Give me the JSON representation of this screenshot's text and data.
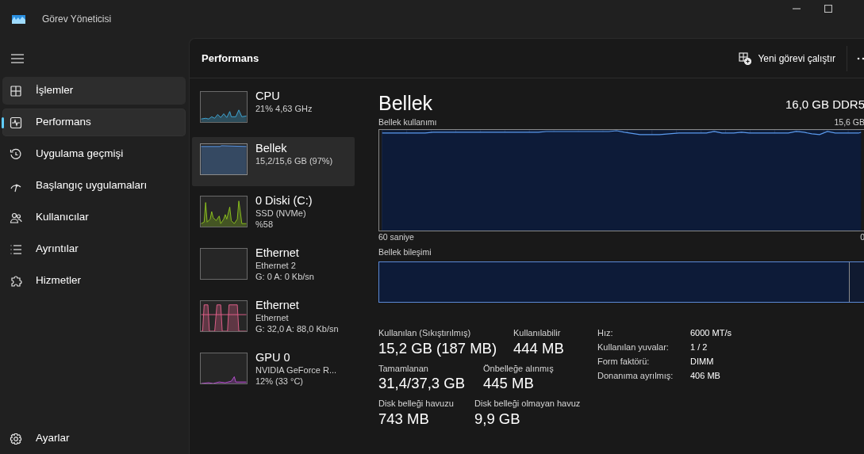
{
  "window": {
    "title": "Görev Yöneticisi"
  },
  "sidebar": {
    "items": [
      {
        "label": "İşlemler",
        "selected": false,
        "hovered": true
      },
      {
        "label": "Performans",
        "selected": true,
        "hovered": false
      },
      {
        "label": "Uygulama geçmişi",
        "selected": false,
        "hovered": false
      },
      {
        "label": "Başlangıç uygulamaları",
        "selected": false,
        "hovered": false
      },
      {
        "label": "Kullanıcılar",
        "selected": false,
        "hovered": false
      },
      {
        "label": "Ayrıntılar",
        "selected": false,
        "hovered": false
      },
      {
        "label": "Hizmetler",
        "selected": false,
        "hovered": false
      }
    ],
    "settings": {
      "label": "Ayarlar"
    }
  },
  "header": {
    "title": "Performans",
    "action": "Yeni görevi çalıştır"
  },
  "devices": [
    {
      "name": "CPU",
      "lines": [
        "21%  4,63 GHz"
      ],
      "selected": false
    },
    {
      "name": "Bellek",
      "lines": [
        "15,2/15,6 GB (97%)"
      ],
      "selected": true
    },
    {
      "name": "0 Diski (C:)",
      "lines": [
        "SSD (NVMe)",
        "%58"
      ],
      "selected": false
    },
    {
      "name": "Ethernet",
      "lines": [
        "Ethernet 2",
        "G: 0 A: 0 Kb/sn"
      ],
      "selected": false
    },
    {
      "name": "Ethernet",
      "lines": [
        "Ethernet",
        "G: 32,0 A: 88,0 Kb/sn"
      ],
      "selected": false
    },
    {
      "name": "GPU 0",
      "lines": [
        "NVIDIA GeForce R...",
        "12%  (33 °C)"
      ],
      "selected": false
    }
  ],
  "detail": {
    "title": "Bellek",
    "spec": "16,0 GB DDR5",
    "usage": {
      "label": "Bellek kullanımı",
      "max": "15,6 GB",
      "time": "60 saniye",
      "min": "0"
    },
    "composition": {
      "label": "Bellek bileşimi",
      "level": 0.97
    },
    "stats": [
      [
        {
          "label": "Kullanılan (Sıkıştırılmış)",
          "value": "15,2 GB (187 MB)"
        },
        {
          "label": "Kullanılabilir",
          "value": "444 MB"
        }
      ],
      [
        {
          "label": "Tamamlanan",
          "value": "31,4/37,3 GB"
        },
        {
          "label": "Önbelleğe alınmış",
          "value": "445 MB"
        }
      ],
      [
        {
          "label": "Disk belleği havuzu",
          "value": "743 MB"
        },
        {
          "label": "Disk belleği olmayan havuz",
          "value": "9,9 GB"
        }
      ]
    ],
    "properties": [
      {
        "key": "Hız:",
        "value": "6000 MT/s"
      },
      {
        "key": "Kullanılan yuvalar:",
        "value": "1 / 2"
      },
      {
        "key": "Form faktörü:",
        "value": "DIMM"
      },
      {
        "key": "Donanıma ayrılmış:",
        "value": "406 MB"
      }
    ]
  }
}
